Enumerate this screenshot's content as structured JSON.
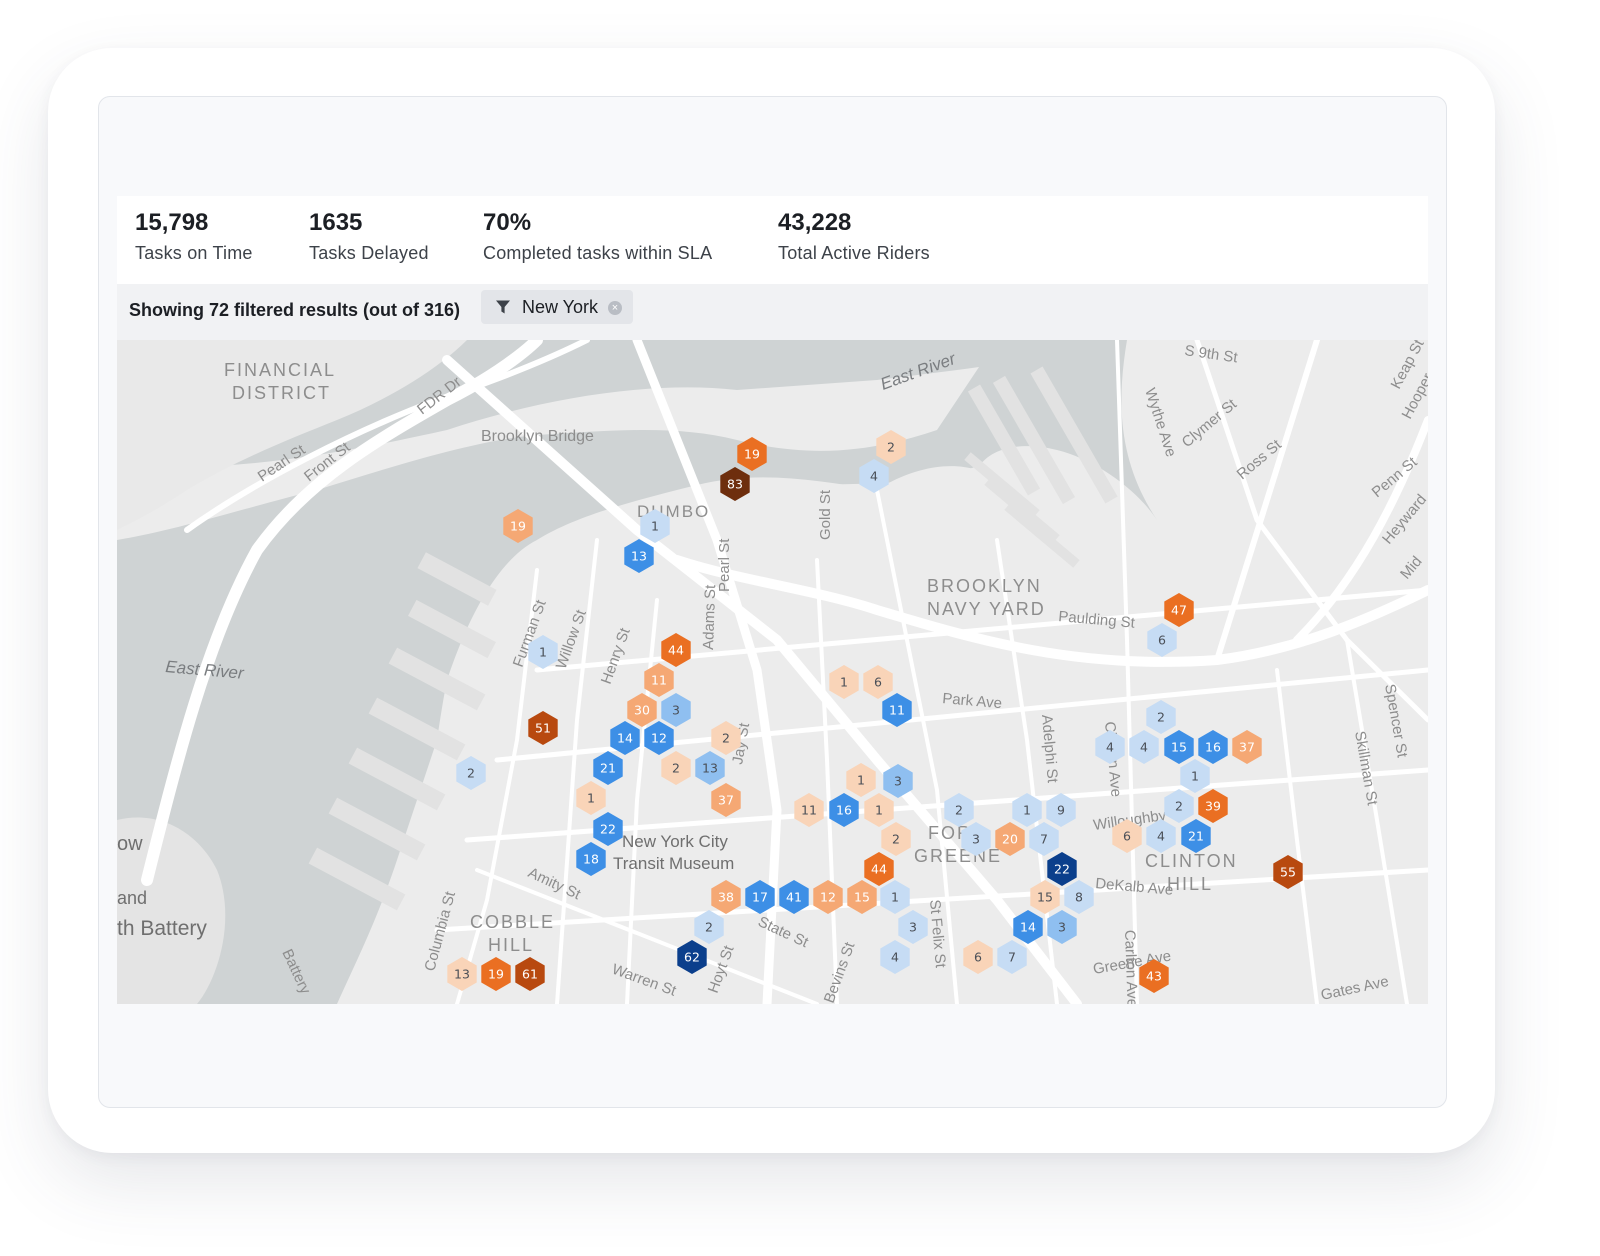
{
  "stats": [
    {
      "value": "15,798",
      "label": "Tasks on Time"
    },
    {
      "value": "1635",
      "label": "Tasks Delayed"
    },
    {
      "value": "70%",
      "label": "Completed tasks within SLA"
    },
    {
      "value": "43,228",
      "label": "Total Active Riders"
    }
  ],
  "filter": {
    "summary": "Showing 72 filtered results (out of 316)",
    "chip_label": "New York",
    "chip_icon": "funnel-icon",
    "clear_icon": "close-circle-icon"
  },
  "map": {
    "place_labels": [
      "FINANCIAL",
      "DISTRICT",
      "Brooklyn Bridge",
      "DUMBO",
      "BROOKLYN",
      "NAVY YARD",
      "COBBLE",
      "HILL",
      "CLINTON",
      "HILL",
      "FORT",
      "GREENE",
      "New York City",
      "Transit Museum",
      "ow",
      "and",
      "th Battery"
    ],
    "water_labels": [
      "East River",
      "East River"
    ],
    "street_labels": [
      "FDR Dr",
      "Pearl St",
      "Front St",
      "S 9th St",
      "Wythe Ave",
      "Clymer St",
      "Ross St",
      "Penn St",
      "Heyward",
      "Keap St",
      "Hooper",
      "Mid",
      "Gold St",
      "Pearl St",
      "Paulding St",
      "Furman St",
      "Willow St",
      "Henry St",
      "Adams St",
      "Jay St",
      "Park Ave",
      "Adelphi St",
      "Spencer St",
      "Skillman St",
      "Amity St",
      "Columbia St",
      "State St",
      "Hoyt St",
      "Bevins St",
      "St Felix St",
      "Warren St",
      "Battery",
      "Greene Ave",
      "Gates Ave",
      "Carlton Ave",
      "DeKalb Ave",
      "Willoughby",
      "Clinton Ave"
    ],
    "colors": {
      "c1": "#c6dcf4",
      "c2": "#8fbff0",
      "c3": "#3d8fe6",
      "c4": "#0b3f8c",
      "o1": "#f9d4b8",
      "o2": "#f5a874",
      "o3": "#ea6f22",
      "o4": "#b8490f",
      "o5": "#6e2e0d"
    },
    "hexes": [
      {
        "n": "19",
        "c": "o3"
      },
      {
        "n": "83",
        "c": "o5"
      },
      {
        "n": "2",
        "c": "o1"
      },
      {
        "n": "4",
        "c": "c1"
      },
      {
        "n": "19",
        "c": "o2"
      },
      {
        "n": "1",
        "c": "c1"
      },
      {
        "n": "13",
        "c": "c3"
      },
      {
        "n": "47",
        "c": "o3"
      },
      {
        "n": "6",
        "c": "c1"
      },
      {
        "n": "1",
        "c": "c1"
      },
      {
        "n": "44",
        "c": "o3"
      },
      {
        "n": "11",
        "c": "o2"
      },
      {
        "n": "30",
        "c": "o2"
      },
      {
        "n": "3",
        "c": "c2"
      },
      {
        "n": "51",
        "c": "o4"
      },
      {
        "n": "14",
        "c": "c3"
      },
      {
        "n": "12",
        "c": "c3"
      },
      {
        "n": "2",
        "c": "o1"
      },
      {
        "n": "1",
        "c": "o1"
      },
      {
        "n": "6",
        "c": "o1"
      },
      {
        "n": "11",
        "c": "c3"
      },
      {
        "n": "2",
        "c": "c1"
      },
      {
        "n": "21",
        "c": "c3"
      },
      {
        "n": "2",
        "c": "o1"
      },
      {
        "n": "13",
        "c": "c2"
      },
      {
        "n": "37",
        "c": "o2"
      },
      {
        "n": "1",
        "c": "o1"
      },
      {
        "n": "22",
        "c": "c3"
      },
      {
        "n": "18",
        "c": "c3"
      },
      {
        "n": "1",
        "c": "o1"
      },
      {
        "n": "3",
        "c": "c2"
      },
      {
        "n": "11",
        "c": "o1"
      },
      {
        "n": "16",
        "c": "c3"
      },
      {
        "n": "1",
        "c": "o1"
      },
      {
        "n": "2",
        "c": "o1"
      },
      {
        "n": "44",
        "c": "o3"
      },
      {
        "n": "2",
        "c": "c1"
      },
      {
        "n": "3",
        "c": "c1"
      },
      {
        "n": "20",
        "c": "o2"
      },
      {
        "n": "1",
        "c": "c1"
      },
      {
        "n": "9",
        "c": "c1"
      },
      {
        "n": "7",
        "c": "c1"
      },
      {
        "n": "22",
        "c": "c4"
      },
      {
        "n": "15",
        "c": "o1"
      },
      {
        "n": "8",
        "c": "c1"
      },
      {
        "n": "14",
        "c": "c3"
      },
      {
        "n": "3",
        "c": "c2"
      },
      {
        "n": "2",
        "c": "c1"
      },
      {
        "n": "4",
        "c": "c1"
      },
      {
        "n": "4",
        "c": "c1"
      },
      {
        "n": "15",
        "c": "c3"
      },
      {
        "n": "16",
        "c": "c3"
      },
      {
        "n": "37",
        "c": "o2"
      },
      {
        "n": "1",
        "c": "c1"
      },
      {
        "n": "2",
        "c": "c1"
      },
      {
        "n": "39",
        "c": "o3"
      },
      {
        "n": "6",
        "c": "o1"
      },
      {
        "n": "4",
        "c": "c1"
      },
      {
        "n": "21",
        "c": "c3"
      },
      {
        "n": "55",
        "c": "o4"
      },
      {
        "n": "38",
        "c": "o2"
      },
      {
        "n": "17",
        "c": "c3"
      },
      {
        "n": "41",
        "c": "c3"
      },
      {
        "n": "12",
        "c": "o2"
      },
      {
        "n": "15",
        "c": "o2"
      },
      {
        "n": "1",
        "c": "c1"
      },
      {
        "n": "2",
        "c": "c1"
      },
      {
        "n": "3",
        "c": "c1"
      },
      {
        "n": "62",
        "c": "c4"
      },
      {
        "n": "4",
        "c": "c1"
      },
      {
        "n": "6",
        "c": "o1"
      },
      {
        "n": "7",
        "c": "c1"
      },
      {
        "n": "43",
        "c": "o3"
      },
      {
        "n": "13",
        "c": "o1"
      },
      {
        "n": "19",
        "c": "o3"
      },
      {
        "n": "61",
        "c": "o4"
      }
    ]
  }
}
